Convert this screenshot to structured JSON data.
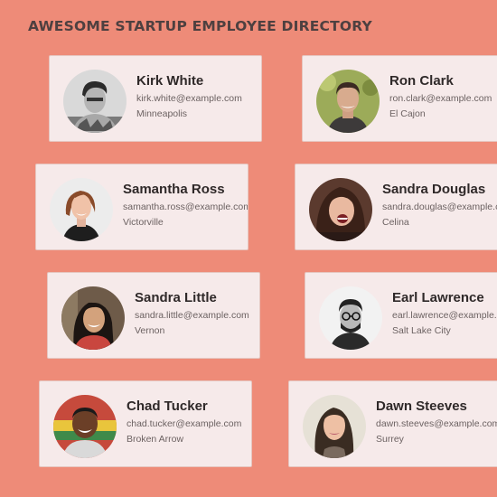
{
  "header": {
    "title": "AWESOME STARTUP EMPLOYEE DIRECTORY"
  },
  "employees": [
    {
      "name": "Kirk White",
      "email": "kirk.white@example.com",
      "city": "Minneapolis",
      "avatar_icon": "person-photo-kirk-white"
    },
    {
      "name": "Ron Clark",
      "email": "ron.clark@example.com",
      "city": "El Cajon",
      "avatar_icon": "person-photo-ron-clark"
    },
    {
      "name": "Samantha Ross",
      "email": "samantha.ross@example.com",
      "city": "Victorville",
      "avatar_icon": "person-photo-samantha-ross"
    },
    {
      "name": "Sandra Douglas",
      "email": "sandra.douglas@example.com",
      "city": "Celina",
      "avatar_icon": "person-photo-sandra-douglas"
    },
    {
      "name": "Sandra Little",
      "email": "sandra.little@example.com",
      "city": "Vernon",
      "avatar_icon": "person-photo-sandra-little"
    },
    {
      "name": "Earl Lawrence",
      "email": "earl.lawrence@example.com",
      "city": "Salt Lake City",
      "avatar_icon": "person-photo-earl-lawrence"
    },
    {
      "name": "Chad Tucker",
      "email": "chad.tucker@example.com",
      "city": "Broken Arrow",
      "avatar_icon": "person-photo-chad-tucker"
    },
    {
      "name": "Dawn Steeves",
      "email": "dawn.steeves@example.com",
      "city": "Surrey",
      "avatar_icon": "person-photo-dawn-steeves"
    }
  ],
  "colors": {
    "background": "#ee8b78",
    "card": "#f6eaea",
    "title_text": "#4e4040"
  }
}
